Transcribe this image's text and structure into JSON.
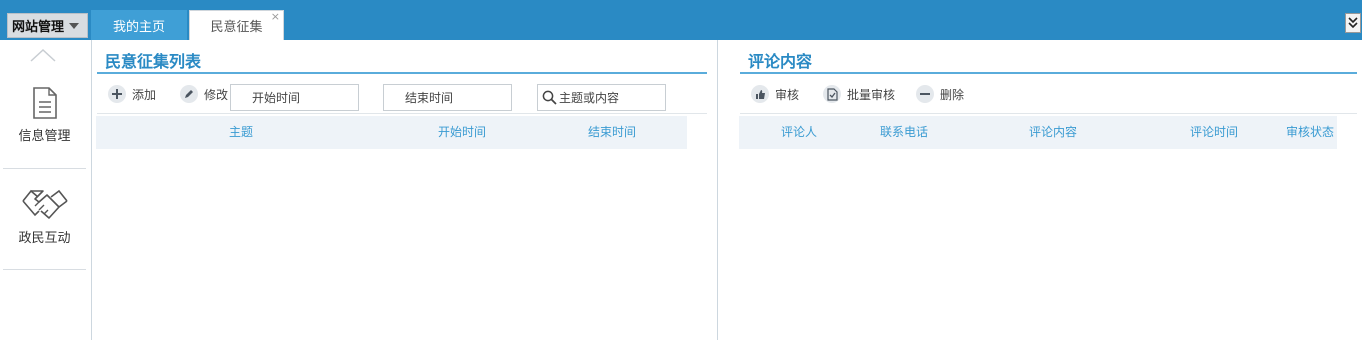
{
  "topbar": {
    "site_menu_label": "网站管理",
    "tabs": [
      {
        "label": "我的主页"
      },
      {
        "label": "民意征集",
        "close": "×"
      }
    ]
  },
  "sidebar": {
    "items": [
      {
        "label": "信息管理",
        "icon": "document-icon"
      },
      {
        "label": "政民互动",
        "icon": "handshake-icon"
      }
    ]
  },
  "left_panel": {
    "title": "民意征集列表",
    "toolbar": {
      "add_label": "添加",
      "edit_label": "修改"
    },
    "filters": {
      "start_time_placeholder": "开始时间",
      "end_time_placeholder": "结束时间",
      "search_placeholder": "主题或内容"
    },
    "columns": [
      "主题",
      "开始时间",
      "结束时间"
    ]
  },
  "right_panel": {
    "title": "评论内容",
    "toolbar": {
      "audit_label": "审核",
      "batch_audit_label": "批量审核",
      "delete_label": "删除"
    },
    "columns": [
      "评论人",
      "联系电话",
      "评论内容",
      "评论时间",
      "审核状态"
    ]
  },
  "colors": {
    "topbar": "#2a8ac4",
    "accent": "#2a8ac4",
    "header_text": "#3a9bd2",
    "table_header_bg": "#eef3f8"
  }
}
